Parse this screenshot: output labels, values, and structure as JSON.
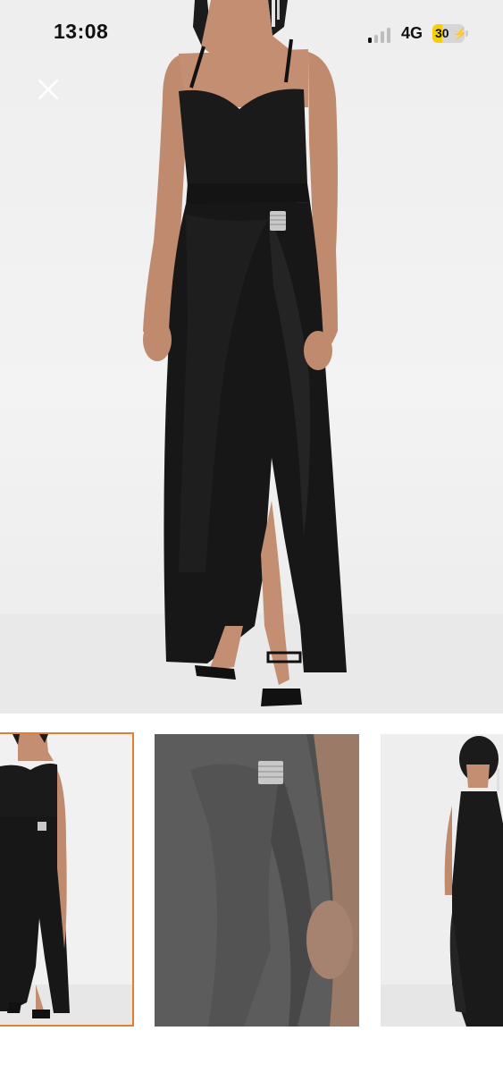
{
  "status_bar": {
    "time": "13:08",
    "network": "4G",
    "battery_level": "30",
    "battery_percent": 30
  },
  "viewer": {
    "close_icon": "close-icon",
    "selected_thumbnail": 1
  },
  "colors": {
    "selected_border": "#e07f31",
    "dress": "#161616",
    "background": "#f0f0f0"
  },
  "thumbnails": [
    {
      "icon": "thumbnail-full-front-view"
    },
    {
      "icon": "thumbnail-buckle-closeup"
    },
    {
      "icon": "thumbnail-back-view"
    }
  ]
}
